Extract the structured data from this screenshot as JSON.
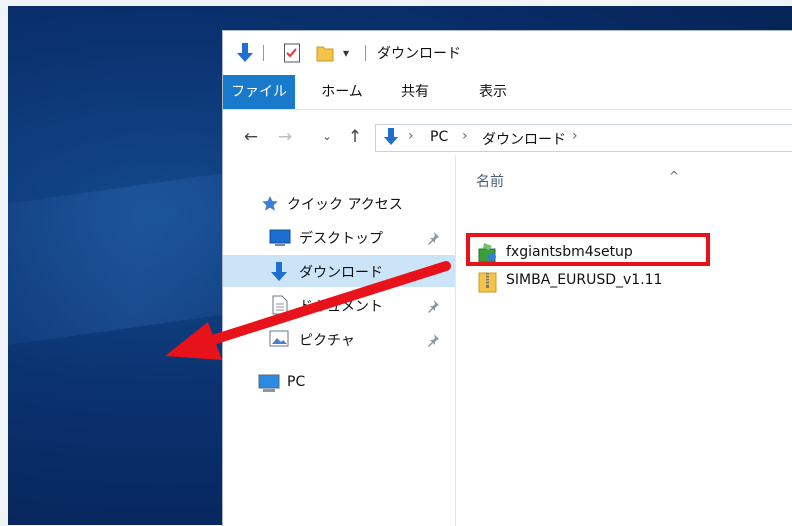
{
  "window": {
    "title": "ダウンロード"
  },
  "ribbon": {
    "tabs": [
      "ファイル",
      "ホーム",
      "共有",
      "表示"
    ]
  },
  "address": {
    "crumbs": [
      "PC",
      "ダウンロード"
    ]
  },
  "nav": {
    "quick_access": "クイック アクセス",
    "items": [
      {
        "label": "デスクトップ",
        "pinned": true,
        "icon": "desktop-icon"
      },
      {
        "label": "ダウンロード",
        "pinned": false,
        "icon": "download-icon",
        "selected": true
      },
      {
        "label": "ドキュメント",
        "pinned": true,
        "icon": "document-icon"
      },
      {
        "label": "ピクチャ",
        "pinned": true,
        "icon": "pictures-icon"
      }
    ],
    "pc": "PC"
  },
  "content": {
    "column_name": "名前",
    "files": [
      {
        "name": "fxgiantsbm4setup",
        "icon": "installer-icon"
      },
      {
        "name": "SIMBA_EURUSD_v1.11",
        "icon": "zip-folder-icon",
        "highlighted": true
      }
    ]
  },
  "colors": {
    "accent": "#1979ca",
    "selection": "#cce4f7",
    "annotation": "#e8121b"
  }
}
